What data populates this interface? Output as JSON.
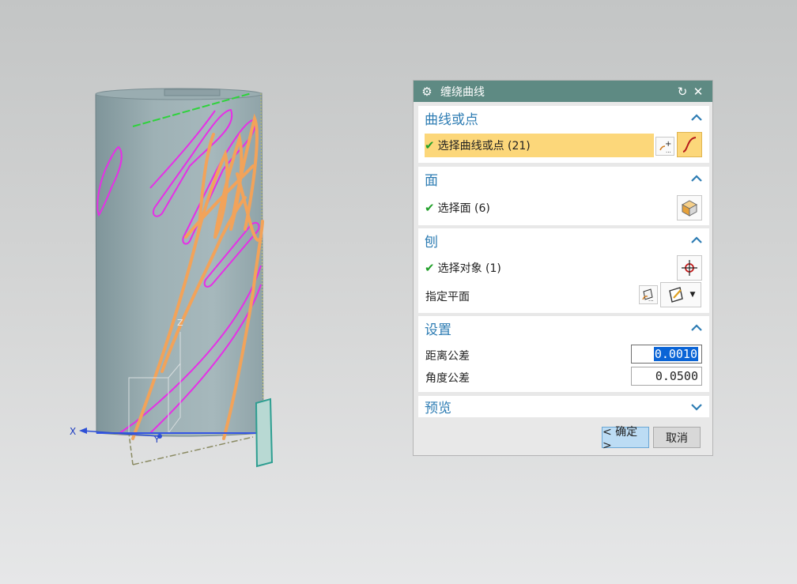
{
  "viewport": {
    "triad": {
      "x_label": "X",
      "y_label": "Y",
      "z_label": "Z"
    }
  },
  "dialog": {
    "title": "缠绕曲线",
    "sections": {
      "curve": {
        "title": "曲线或点",
        "select_label": "选择曲线或点 (21)"
      },
      "face": {
        "title": "面",
        "select_label": "选择面 (6)"
      },
      "plane": {
        "title": "刨",
        "select_label": "选择对象 (1)",
        "specify_label": "指定平面"
      },
      "settings": {
        "title": "设置",
        "distance_label": "距离公差",
        "distance_value": "0.0010",
        "angle_label": "角度公差",
        "angle_value": "0.0500"
      },
      "preview": {
        "title": "预览"
      }
    },
    "ok_label": "< 确定 >",
    "cancel_label": "取消",
    "colors": {
      "titlebar": "#5e8a83",
      "section_title": "#2d7cb3",
      "selection_highlight": "#fcd77a",
      "check": "#22a02a"
    }
  }
}
